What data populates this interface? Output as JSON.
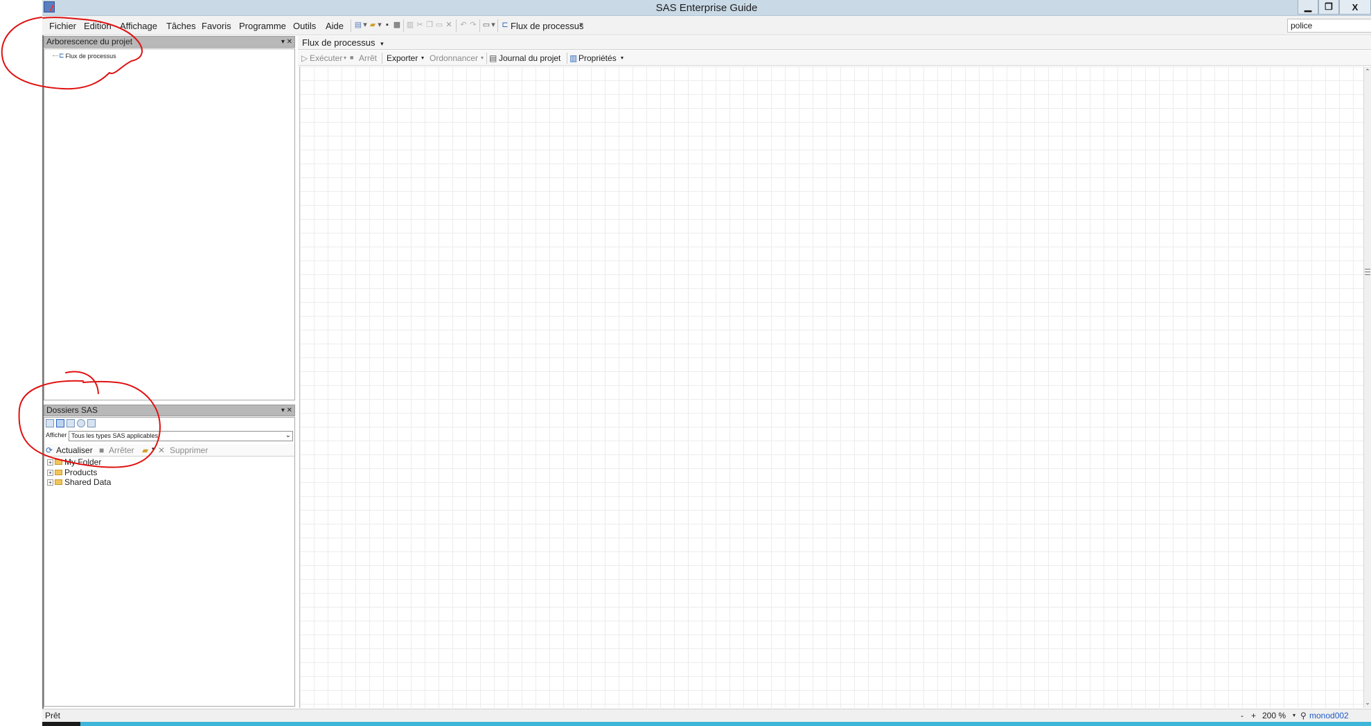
{
  "window": {
    "title": "SAS Enterprise Guide",
    "buttons": {
      "minimize": "▁",
      "restore": "❐",
      "close": "X"
    }
  },
  "menu": {
    "items": [
      "Fichier",
      "Edition",
      "Affichage",
      "Tâches",
      "Favoris",
      "Programme",
      "Outils",
      "Aide"
    ],
    "flow_label": "Flux de processus",
    "search_value": "police",
    "search_clear": "✕"
  },
  "project_tree": {
    "title": "Arborescence du projet",
    "controls": "▾ ✕",
    "root_item": "Flux de processus"
  },
  "sas_folders": {
    "title": "Dossiers SAS",
    "controls": "▾ ✕",
    "filter_label": "Afficher",
    "filter_value": "Tous les types SAS applicables",
    "toolbar": {
      "refresh": "Actualiser",
      "stop": "Arrêter",
      "delete": "Supprimer"
    },
    "folders": [
      "My Folder",
      "Products",
      "Shared Data"
    ]
  },
  "main": {
    "tab_label": "Flux de processus",
    "toolbar": {
      "run": "Exécuter",
      "stop": "Arrêt",
      "export": "Exporter",
      "schedule": "Ordonnancer",
      "log": "Journal du projet",
      "properties": "Propriétés"
    }
  },
  "status": {
    "text": "Prêt",
    "zoom_minus": "-",
    "zoom_plus": "+",
    "zoom_value": "200 %",
    "user": "monod002"
  },
  "colors": {
    "annotation": "#e01010",
    "titlebar": "#c9d9e6",
    "link": "#1e5bc6"
  }
}
